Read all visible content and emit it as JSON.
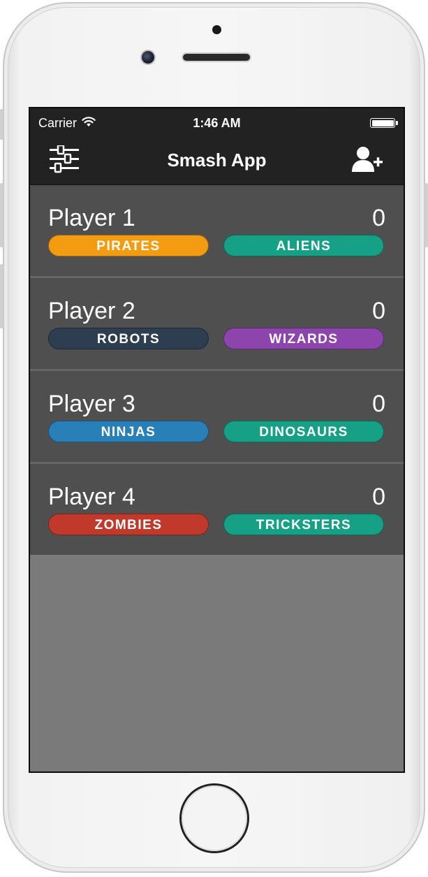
{
  "status_bar": {
    "carrier": "Carrier",
    "time": "1:46 AM",
    "wifi_icon": "wifi-icon",
    "battery_icon": "battery-icon"
  },
  "nav": {
    "title": "Smash App",
    "left_icon": "sliders-icon",
    "right_icon": "add-user-icon"
  },
  "players": [
    {
      "name": "Player 1",
      "score": "0",
      "teams": [
        {
          "label": "PIRATES",
          "color": "#F39C12"
        },
        {
          "label": "ALIENS",
          "color": "#16A085"
        }
      ]
    },
    {
      "name": "Player 2",
      "score": "0",
      "teams": [
        {
          "label": "ROBOTS",
          "color": "#2C3E50"
        },
        {
          "label": "WIZARDS",
          "color": "#8E44AD"
        }
      ]
    },
    {
      "name": "Player 3",
      "score": "0",
      "teams": [
        {
          "label": "NINJAS",
          "color": "#2980B9"
        },
        {
          "label": "DINOSAURS",
          "color": "#16A085"
        }
      ]
    },
    {
      "name": "Player 4",
      "score": "0",
      "teams": [
        {
          "label": "ZOMBIES",
          "color": "#C0392B"
        },
        {
          "label": "TRICKSTERS",
          "color": "#16A085"
        }
      ]
    }
  ],
  "colors": {
    "bar_background": "#222222",
    "row_background": "#4F4F4F",
    "row_divider": "#666666",
    "empty_background": "#7A7A7A"
  }
}
